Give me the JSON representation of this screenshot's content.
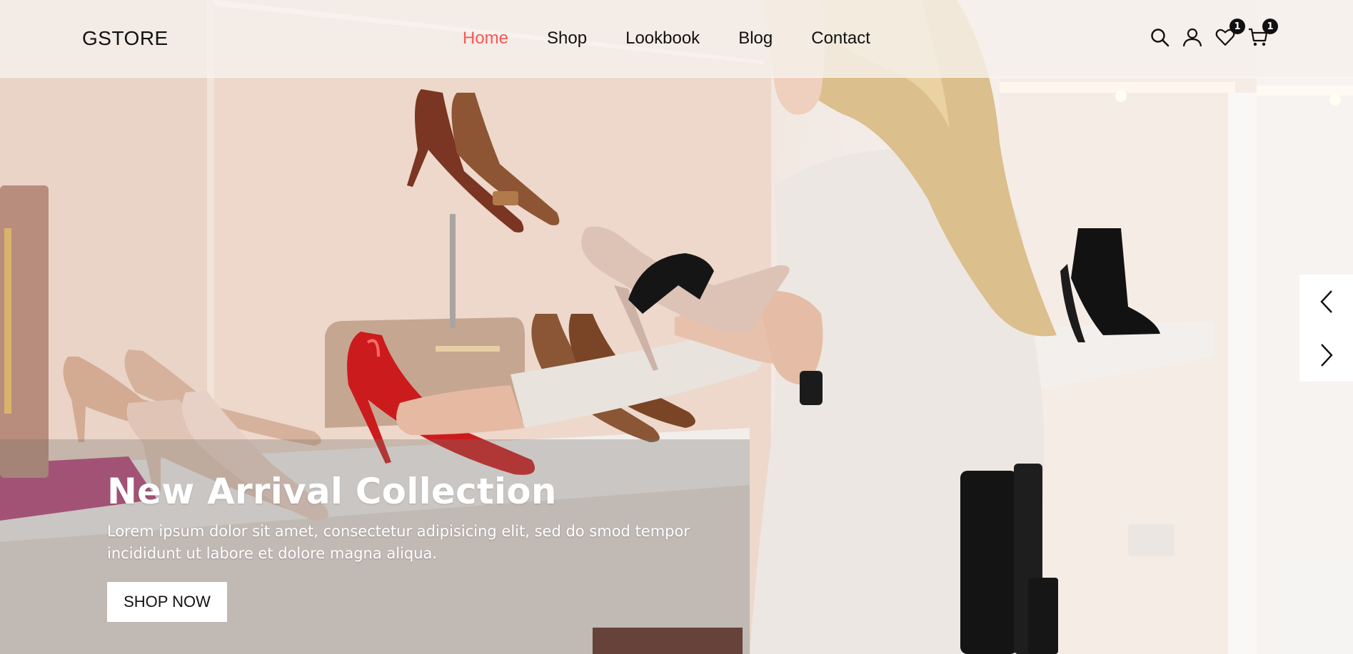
{
  "brand": {
    "logo_text": "GSTORE"
  },
  "nav": {
    "items": [
      {
        "label": "Home",
        "active": true
      },
      {
        "label": "Shop",
        "active": false
      },
      {
        "label": "Lookbook",
        "active": false
      },
      {
        "label": "Blog",
        "active": false
      },
      {
        "label": "Contact",
        "active": false
      }
    ],
    "active_color": "#f35a58"
  },
  "header_icons": {
    "search": {
      "icon": "search-icon"
    },
    "account": {
      "icon": "user-icon"
    },
    "wishlist": {
      "icon": "heart-icon",
      "count": "1"
    },
    "cart": {
      "icon": "cart-icon",
      "count": "1"
    }
  },
  "slider": {
    "prev_icon": "chevron-left-icon",
    "next_icon": "chevron-right-icon"
  },
  "hero": {
    "title": "New Arrival Collection",
    "description": "Lorem ipsum dolor sit amet, consectetur adipisicing elit, sed do smod tempor incididunt ut labore et dolore magna aliqua.",
    "cta_label": "SHOP NOW"
  }
}
